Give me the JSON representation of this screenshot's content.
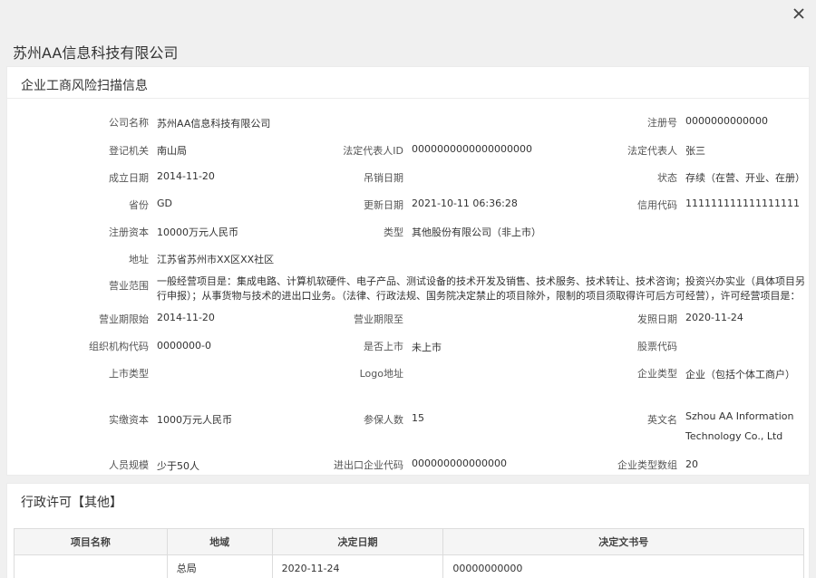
{
  "dialog": {
    "company_title": "苏州AA信息科技有限公司",
    "close_icon": "close-icon"
  },
  "risk": {
    "title": "企业工商风险扫描信息",
    "rows": [
      [
        {
          "label": "公司名称",
          "value": "苏州AA信息科技有限公司"
        },
        {
          "label": "",
          "value": ""
        },
        {
          "label": "注册号",
          "value": "0000000000000"
        }
      ],
      [
        {
          "label": "登记机关",
          "value": "南山局"
        },
        {
          "label": "法定代表人ID",
          "value": "0000000000000000000"
        },
        {
          "label": "法定代表人",
          "value": "张三"
        }
      ],
      [
        {
          "label": "成立日期",
          "value": "2014-11-20"
        },
        {
          "label": "吊销日期",
          "value": ""
        },
        {
          "label": "状态",
          "value": "存续（在营、开业、在册）"
        }
      ],
      [
        {
          "label": "省份",
          "value": "GD"
        },
        {
          "label": "更新日期",
          "value": "2021-10-11 06:36:28"
        },
        {
          "label": "信用代码",
          "value": "111111111111111111"
        }
      ],
      [
        {
          "label": "注册资本",
          "value": "10000万元人民币"
        },
        {
          "label": "类型",
          "value": "其他股份有限公司（非上市）"
        },
        {
          "label": "",
          "value": ""
        }
      ],
      [
        {
          "label": "地址",
          "value": "江苏省苏州市XX区XX社区"
        }
      ],
      [
        {
          "label": "营业范围",
          "value": "一般经营项目是：集成电路、计算机软硬件、电子产品、测试设备的技术开发及销售、技术服务、技术转让、技术咨询；投资兴办实业（具体项目另行申报）；从事货物与技术的进出口业务。（法律、行政法规、国务院决定禁止的项目除外，限制的项目须取得许可后方可经营），许可经营项目是："
        }
      ],
      [
        {
          "label": "营业期限始",
          "value": "2014-11-20"
        },
        {
          "label": "营业期限至",
          "value": ""
        },
        {
          "label": "发照日期",
          "value": "2020-11-24"
        }
      ],
      [
        {
          "label": "组织机构代码",
          "value": "0000000-0"
        },
        {
          "label": "是否上市",
          "value": "未上市"
        },
        {
          "label": "股票代码",
          "value": ""
        }
      ],
      [
        {
          "label": "上市类型",
          "value": ""
        },
        {
          "label": "Logo地址",
          "value": ""
        },
        {
          "label": "企业类型",
          "value": "企业（包括个体工商户）"
        }
      ],
      [
        {
          "label": "实缴资本",
          "value": "1000万元人民币"
        },
        {
          "label": "参保人数",
          "value": "15"
        },
        {
          "label": "英文名",
          "value": "Szhou AA Information Technology Co., Ltd"
        }
      ],
      [
        {
          "label": "人员规模",
          "value": "少于50人"
        },
        {
          "label": "进出口企业代码",
          "value": "000000000000000"
        },
        {
          "label": "企业类型数组",
          "value": "20"
        }
      ]
    ]
  },
  "license": {
    "title": "行政许可【其他】",
    "headers": [
      "项目名称",
      "地域",
      "决定日期",
      "决定文书号"
    ],
    "rows": [
      [
        "",
        "总局",
        "2020-11-24",
        "00000000000"
      ]
    ]
  }
}
